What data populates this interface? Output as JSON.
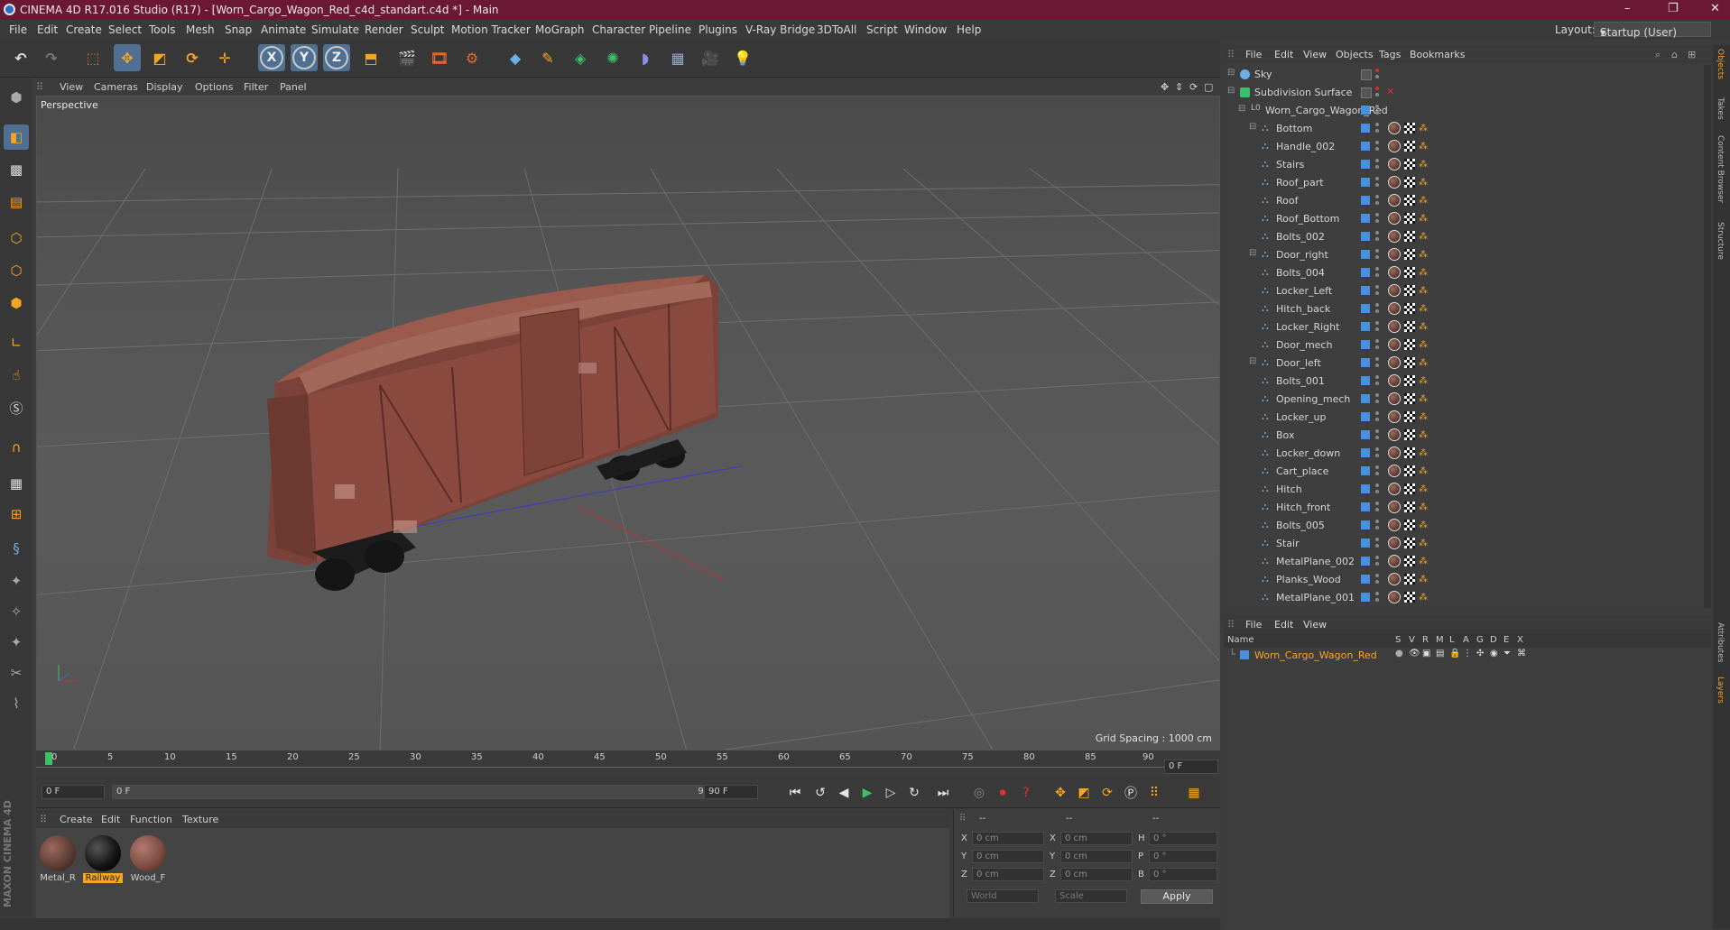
{
  "titlebar": {
    "title": "CINEMA 4D R17.016 Studio (R17) - [Worn_Cargo_Wagon_Red_c4d_standart.c4d *] - Main",
    "minimize": "–",
    "maximize": "❐",
    "close": "✕"
  },
  "menubar": {
    "items": [
      "File",
      "Edit",
      "Create",
      "Select",
      "Tools",
      "Mesh",
      "Snap",
      "Animate",
      "Simulate",
      "Render",
      "Sculpt",
      "Motion Tracker",
      "MoGraph",
      "Character",
      "Pipeline",
      "Plugins",
      "V-Ray Bridge",
      "3DToAll",
      "Script",
      "Window",
      "Help"
    ],
    "layout_label": "Layout:",
    "layout_value": "Startup (User)"
  },
  "toolbar": {
    "axis_x": "X",
    "axis_y": "Y",
    "axis_z": "Z"
  },
  "viewport": {
    "menu": [
      "View",
      "Cameras",
      "Display",
      "Options",
      "Filter",
      "Panel"
    ],
    "camera_label": "Perspective",
    "grid_spacing": "Grid Spacing : 1000 cm"
  },
  "timeline": {
    "ticks": [
      "0",
      "5",
      "10",
      "15",
      "20",
      "25",
      "30",
      "35",
      "40",
      "45",
      "50",
      "55",
      "60",
      "65",
      "70",
      "75",
      "80",
      "85",
      "90"
    ],
    "current_frame": "0 F"
  },
  "transport": {
    "start_field": "0 F",
    "range_start": "0 F",
    "range_end": "90 F",
    "end_field": "90 F"
  },
  "materials": {
    "menu": [
      "Create",
      "Edit",
      "Function",
      "Texture"
    ],
    "items": [
      {
        "name": "Metal_R",
        "color": "#5a3a32"
      },
      {
        "name": "Railway",
        "color": "#111111"
      },
      {
        "name": "Wood_F",
        "color": "#7a4a40"
      }
    ]
  },
  "coordinates": {
    "col_headers": [
      "--",
      "--",
      "--"
    ],
    "rows": [
      {
        "l1": "X",
        "v1": "0 cm",
        "l2": "X",
        "v2": "0 cm",
        "l3": "H",
        "v3": "0 °"
      },
      {
        "l1": "Y",
        "v1": "0 cm",
        "l2": "Y",
        "v2": "0 cm",
        "l3": "P",
        "v3": "0 °"
      },
      {
        "l1": "Z",
        "v1": "0 cm",
        "l2": "Z",
        "v2": "0 cm",
        "l3": "B",
        "v3": "0 °"
      }
    ],
    "mode": "World",
    "scale": "Scale",
    "apply": "Apply"
  },
  "object_manager": {
    "menu": [
      "File",
      "Edit",
      "View",
      "Objects",
      "Tags",
      "Bookmarks"
    ],
    "objects": [
      {
        "name": "Sky",
        "level": 0,
        "type": "sky"
      },
      {
        "name": "Subdivision Surface",
        "level": 0,
        "type": "subdiv"
      },
      {
        "name": "Worn_Cargo_Wagon_Red",
        "level": 1,
        "type": "null"
      },
      {
        "name": "Bottom",
        "level": 2,
        "type": "mesh"
      },
      {
        "name": "Handle_002",
        "level": 2,
        "type": "mesh"
      },
      {
        "name": "Stairs",
        "level": 2,
        "type": "mesh"
      },
      {
        "name": "Roof_part",
        "level": 2,
        "type": "mesh"
      },
      {
        "name": "Roof",
        "level": 2,
        "type": "mesh"
      },
      {
        "name": "Roof_Bottom",
        "level": 2,
        "type": "mesh"
      },
      {
        "name": "Bolts_002",
        "level": 2,
        "type": "mesh"
      },
      {
        "name": "Door_right",
        "level": 2,
        "type": "mesh"
      },
      {
        "name": "Bolts_004",
        "level": 2,
        "type": "mesh"
      },
      {
        "name": "Locker_Left",
        "level": 2,
        "type": "mesh"
      },
      {
        "name": "Hitch_back",
        "level": 2,
        "type": "mesh"
      },
      {
        "name": "Locker_Right",
        "level": 2,
        "type": "mesh"
      },
      {
        "name": "Door_mech",
        "level": 2,
        "type": "mesh"
      },
      {
        "name": "Door_left",
        "level": 2,
        "type": "mesh"
      },
      {
        "name": "Bolts_001",
        "level": 2,
        "type": "mesh"
      },
      {
        "name": "Opening_mech",
        "level": 2,
        "type": "mesh"
      },
      {
        "name": "Locker_up",
        "level": 2,
        "type": "mesh"
      },
      {
        "name": "Box",
        "level": 2,
        "type": "mesh"
      },
      {
        "name": "Locker_down",
        "level": 2,
        "type": "mesh"
      },
      {
        "name": "Cart_place",
        "level": 2,
        "type": "mesh"
      },
      {
        "name": "Hitch",
        "level": 2,
        "type": "mesh"
      },
      {
        "name": "Hitch_front",
        "level": 2,
        "type": "mesh"
      },
      {
        "name": "Bolts_005",
        "level": 2,
        "type": "mesh"
      },
      {
        "name": "Stair",
        "level": 2,
        "type": "mesh"
      },
      {
        "name": "MetalPlane_002",
        "level": 2,
        "type": "mesh"
      },
      {
        "name": "Planks_Wood",
        "level": 2,
        "type": "mesh"
      },
      {
        "name": "MetalPlane_001",
        "level": 2,
        "type": "mesh"
      }
    ]
  },
  "layer_manager": {
    "menu": [
      "File",
      "Edit",
      "View"
    ],
    "columns": [
      "Name",
      "S",
      "V",
      "R",
      "M",
      "L",
      "A",
      "G",
      "D",
      "E",
      "X"
    ],
    "layers": [
      {
        "name": "Worn_Cargo_Wagon_Red",
        "color": "#f5a623"
      }
    ]
  },
  "right_tabs": [
    "Objects",
    "Takes",
    "Content Browser",
    "Structure",
    "Attributes",
    "Layers"
  ],
  "brand": "MAXON CINEMA 4D"
}
